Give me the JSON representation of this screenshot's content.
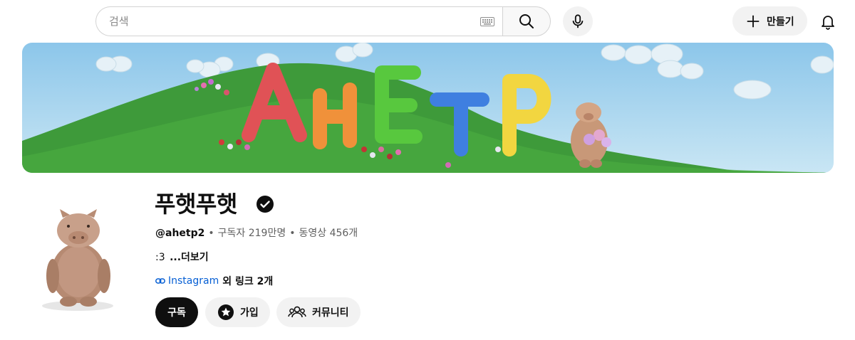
{
  "search": {
    "placeholder": "검색",
    "value": ""
  },
  "header": {
    "create_label": "만들기"
  },
  "banner": {
    "letters": [
      "A",
      "H",
      "E",
      "T",
      "P"
    ]
  },
  "channel": {
    "name": "푸햇푸햇",
    "handle": "@ahetp2",
    "subscribers": "구독자 219만명",
    "videos": "동영상 456개",
    "description": ":3",
    "more_label": "...더보기",
    "link_text": "Instagram",
    "link_more": "외 링크 2개"
  },
  "actions": {
    "subscribe_label": "구독",
    "join_label": "가입",
    "community_label": "커뮤니티"
  },
  "colors": {
    "subscribe_bg": "#0f0f0f",
    "link": "#065fd4",
    "chip_bg": "#f2f2f2",
    "banner_sky": "#8fc7e8",
    "banner_hill": "#3f9e3a"
  },
  "icons": {
    "keyboard": "keyboard-icon",
    "search": "search-icon",
    "mic": "mic-icon",
    "create": "plus-icon",
    "notifications": "bell-icon",
    "verified": "verified-check-icon",
    "link": "link-icon",
    "join": "star-badge-icon",
    "community": "people-icon"
  }
}
